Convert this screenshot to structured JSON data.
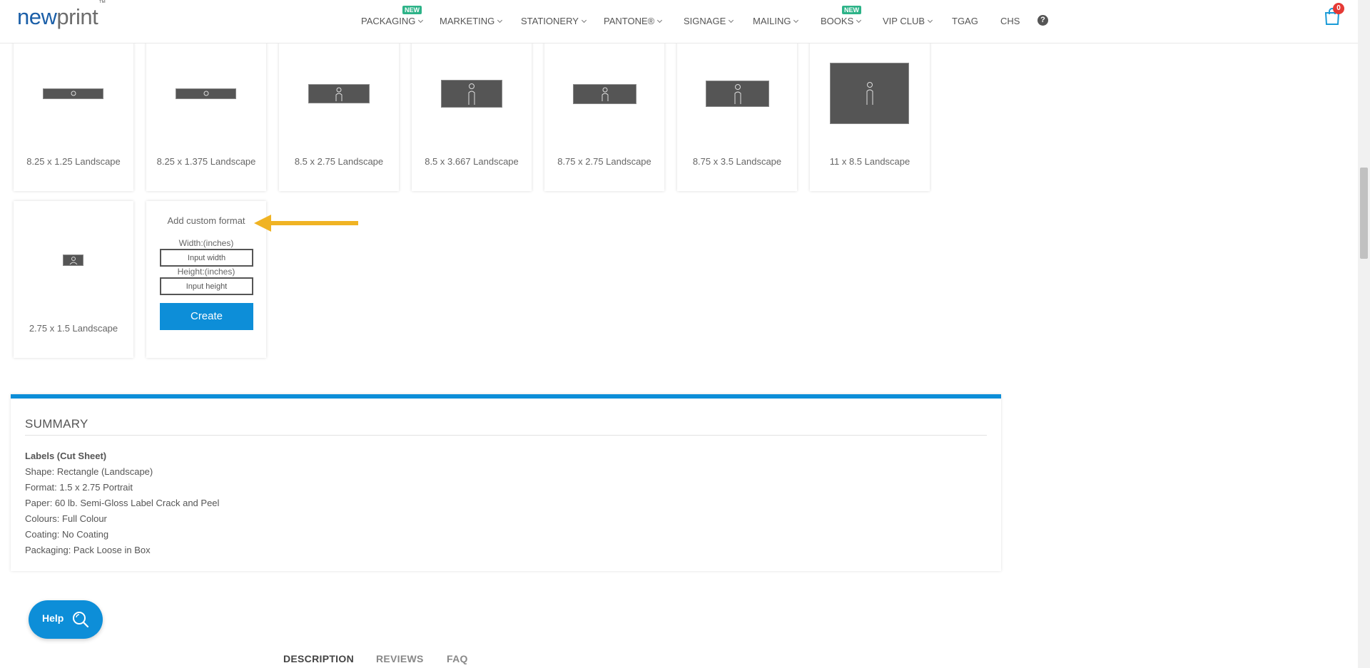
{
  "header": {
    "logo_part1": "new",
    "logo_part2": "print",
    "logo_tm": "™",
    "nav": [
      {
        "label": "PACKAGING",
        "badge": "NEW"
      },
      {
        "label": "MARKETING"
      },
      {
        "label": "STATIONERY"
      },
      {
        "label": "PANTONE®"
      },
      {
        "label": "SIGNAGE"
      },
      {
        "label": "MAILING"
      },
      {
        "label": "BOOKS",
        "badge": "NEW"
      },
      {
        "label": "VIP CLUB"
      },
      {
        "label": "TGAG"
      },
      {
        "label": "CHS"
      }
    ],
    "help_icon": "question-circle-icon",
    "cart_icon": "shopping-bag-icon",
    "cart_count": "0"
  },
  "formats": [
    {
      "label": "8.25 x 1.25 Landscape"
    },
    {
      "label": "8.25 x 1.375 Landscape"
    },
    {
      "label": "8.5 x 2.75 Landscape"
    },
    {
      "label": "8.5 x 3.667 Landscape"
    },
    {
      "label": "8.75 x 2.75 Landscape"
    },
    {
      "label": "8.75 x 3.5 Landscape"
    },
    {
      "label": "11 x 8.5 Landscape"
    },
    {
      "label": "2.75 x 1.5 Landscape"
    }
  ],
  "custom_format": {
    "title": "Add custom format",
    "width_label": "Width:(inches)",
    "width_placeholder": "Input width",
    "height_label": "Height:(inches)",
    "height_placeholder": "Input height",
    "create_label": "Create"
  },
  "summary": {
    "title": "SUMMARY",
    "product": "Labels (Cut Sheet)",
    "lines": [
      "Shape: Rectangle (Landscape)",
      "Format: 1.5 x 2.75 Portrait",
      "Paper: 60 lb. Semi-Gloss Label Crack and Peel",
      "Colours: Full Colour",
      "Coating: No Coating",
      "Packaging: Pack Loose in Box"
    ]
  },
  "help_button": {
    "label": "Help",
    "icon": "search-icon"
  },
  "tabs": [
    {
      "label": "DESCRIPTION",
      "active": true
    },
    {
      "label": "REVIEWS"
    },
    {
      "label": "FAQ"
    }
  ],
  "colors": {
    "accent": "#0d8ed8",
    "arrow": "#f0b323",
    "badge": "#2db388",
    "cart_badge": "#e53935"
  }
}
